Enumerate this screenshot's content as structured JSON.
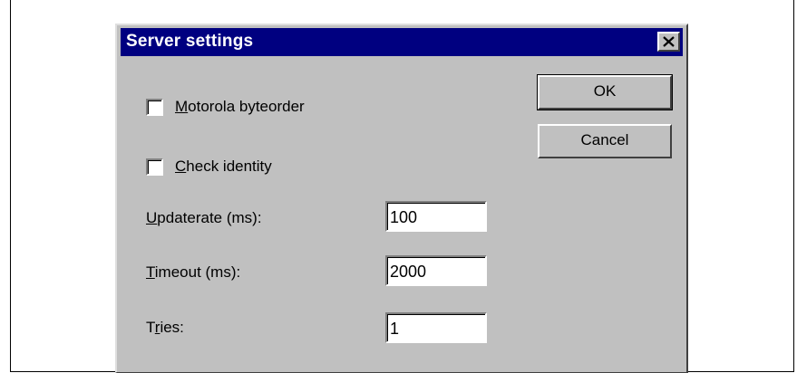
{
  "dialog": {
    "title": "Server settings",
    "checkboxes": [
      {
        "mnemonic": "M",
        "rest": "otorola byteorder",
        "checked": false
      },
      {
        "mnemonic": "C",
        "rest": "heck identity",
        "checked": false
      }
    ],
    "fields": [
      {
        "pre": "",
        "mnemonic": "U",
        "post": "pdaterate (ms):",
        "value": "100"
      },
      {
        "pre": "",
        "mnemonic": "T",
        "post": "imeout (ms):",
        "value": "2000"
      },
      {
        "pre": "T",
        "mnemonic": "r",
        "post": "ies:",
        "value": "1"
      }
    ],
    "buttons": {
      "ok": "OK",
      "cancel": "Cancel"
    }
  }
}
